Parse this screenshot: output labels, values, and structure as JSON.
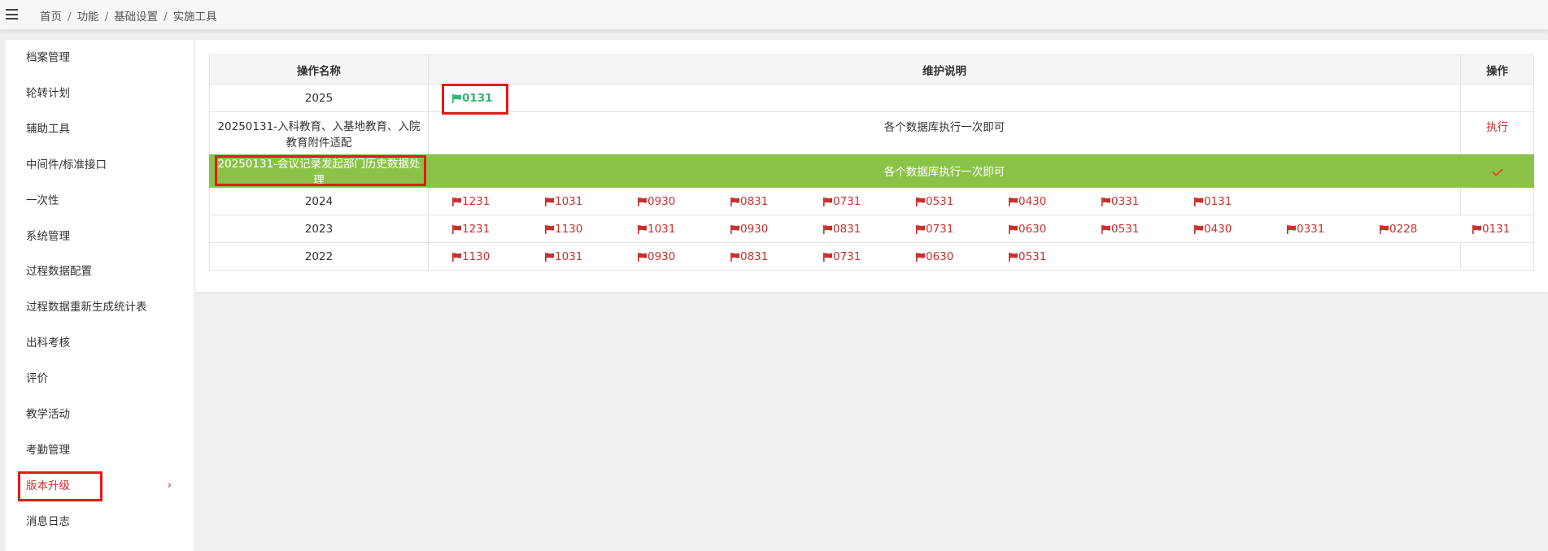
{
  "breadcrumb": [
    "首页",
    "功能",
    "基础设置",
    "实施工具"
  ],
  "sidebar": {
    "items": [
      {
        "label": "档案管理"
      },
      {
        "label": "轮转计划"
      },
      {
        "label": "辅助工具"
      },
      {
        "label": "中间件/标准接口"
      },
      {
        "label": "一次性"
      },
      {
        "label": "系统管理"
      },
      {
        "label": "过程数据配置"
      },
      {
        "label": "过程数据重新生成统计表"
      },
      {
        "label": "出科考核"
      },
      {
        "label": "评价"
      },
      {
        "label": "教学活动"
      },
      {
        "label": "考勤管理"
      },
      {
        "label": "版本升级",
        "active": true
      },
      {
        "label": "消息日志"
      }
    ]
  },
  "table": {
    "headers": {
      "name": "操作名称",
      "desc": "维护说明",
      "op": "操作"
    },
    "rows": [
      {
        "name": "2025",
        "flags": [
          "0131"
        ],
        "flag_color": "green"
      },
      {
        "name": "20250131-入科教育、入基地教育、入院教育附件适配",
        "desc": "各个数据库执行一次即可",
        "op": "执行"
      },
      {
        "name": "20250131-会议记录发起部门历史数据处理",
        "desc": "各个数据库执行一次即可",
        "op": "done",
        "highlighted": true
      },
      {
        "name": "2024",
        "flags": [
          "1231",
          "1031",
          "0930",
          "0831",
          "0731",
          "0531",
          "0430",
          "0331",
          "0131"
        ]
      },
      {
        "name": "2023",
        "flags": [
          "1231",
          "1130",
          "1031",
          "0930",
          "0831",
          "0731",
          "0630",
          "0531",
          "0430",
          "0331",
          "0228",
          "0131"
        ]
      },
      {
        "name": "2022",
        "flags": [
          "1130",
          "1031",
          "0930",
          "0831",
          "0731",
          "0630",
          "0531"
        ]
      }
    ]
  },
  "colors": {
    "accent": "#c9302c",
    "highlight": "#8bc34a",
    "flag_red": "#c9302c",
    "flag_green": "#2eb872",
    "annotation": "#e41a1a"
  },
  "icons": {
    "menu": "hamburger-icon",
    "flag": "flag-icon",
    "chevron": "chevron-right-icon",
    "done": "check-icon"
  }
}
